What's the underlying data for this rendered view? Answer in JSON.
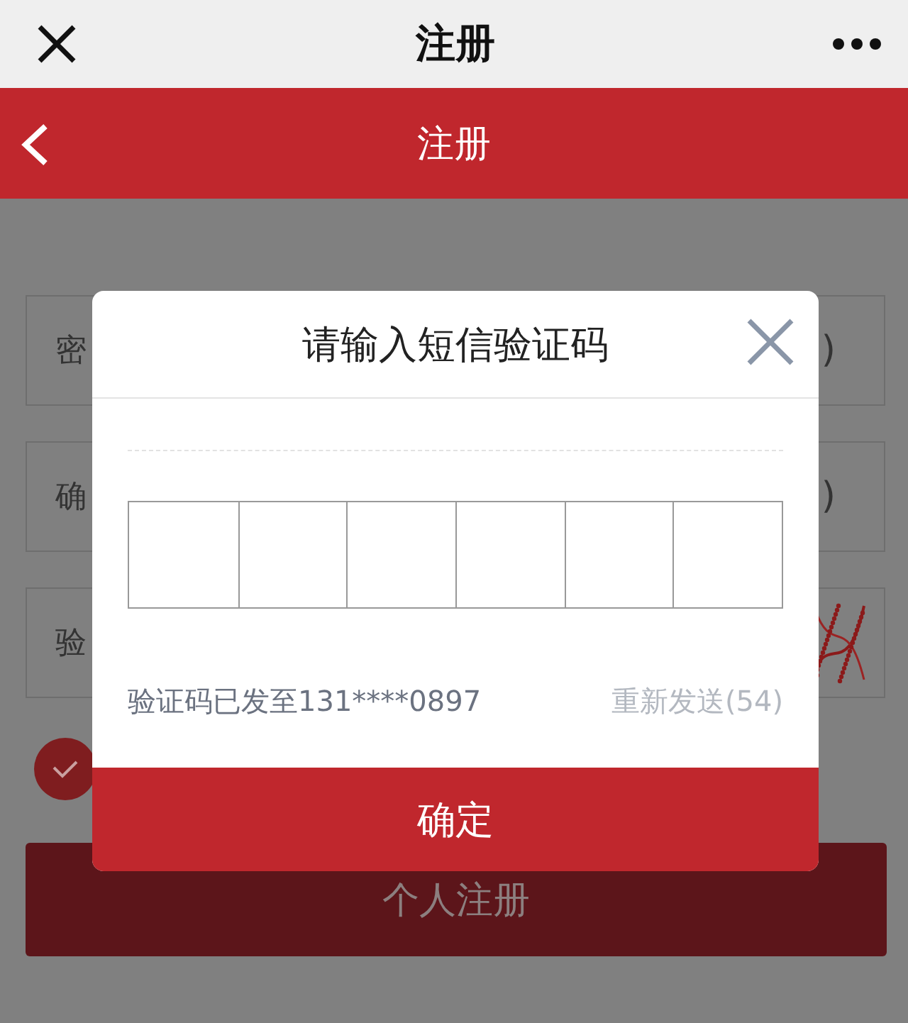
{
  "top_bar": {
    "title": "注册"
  },
  "header": {
    "title": "注册"
  },
  "fields": [
    {
      "label": "密",
      "suffix": ")",
      "kind": "text"
    },
    {
      "label": "确",
      "suffix": ")",
      "kind": "text"
    },
    {
      "label": "验",
      "kind": "captcha"
    }
  ],
  "agree": {
    "checked": true
  },
  "register_button": "个人注册",
  "dialog": {
    "title": "请输入短信验证码",
    "code_boxes": [
      {
        "filled": false
      },
      {
        "filled": false
      },
      {
        "filled": false
      },
      {
        "filled": false
      },
      {
        "filled": false
      },
      {
        "filled": false
      }
    ],
    "sent_text": "验证码已发至131****0897",
    "resend": {
      "label": "重新发送(54)",
      "disabled": true
    },
    "confirm": "确定"
  }
}
